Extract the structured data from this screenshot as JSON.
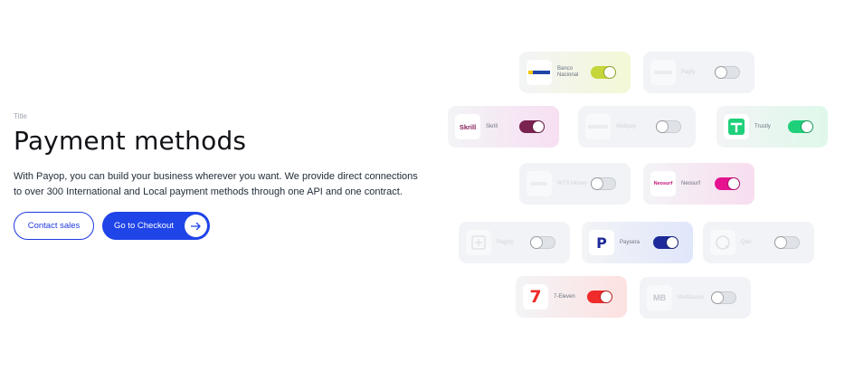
{
  "hero": {
    "eyebrow": "Title",
    "title": "Payment methods",
    "description": "With Payop, you can build your business wherever you want. We provide direct connections to over 300 International and Local payment methods through one API and one contract.",
    "contact_label": "Contact sales",
    "checkout_label": "Go to Checkout"
  },
  "methods": [
    {
      "name": "Banco Nacional",
      "enabled": true,
      "accent": "#c4d63a",
      "bg": "#f3f8d6"
    },
    {
      "name": "Pagfy",
      "enabled": false
    },
    {
      "name": "Skrill",
      "enabled": true,
      "accent": "#7a2250",
      "bg": "#f7dff2"
    },
    {
      "name": "Webpay",
      "enabled": false
    },
    {
      "name": "Trustly",
      "enabled": true,
      "accent": "#1fd07a",
      "bg": "#dff8ea"
    },
    {
      "name": "WTS Money",
      "enabled": false
    },
    {
      "name": "Neosurf",
      "enabled": true,
      "accent": "#e5138f",
      "bg": "#f8ddef"
    },
    {
      "name": "Pagofy",
      "enabled": false
    },
    {
      "name": "Paysera",
      "enabled": true,
      "accent": "#1e2a99",
      "bg": "#e0e6fb"
    },
    {
      "name": "Qiwi",
      "enabled": false
    },
    {
      "name": "7-Eleven",
      "enabled": true,
      "accent": "#ef2b2b",
      "bg": "#fde1e1"
    },
    {
      "name": "Multibanco",
      "enabled": false
    }
  ],
  "logos": {
    "skrill": "Skrill",
    "neosurf": "Neosurf",
    "paysera": "P",
    "seven": "7",
    "mb": "MB"
  }
}
